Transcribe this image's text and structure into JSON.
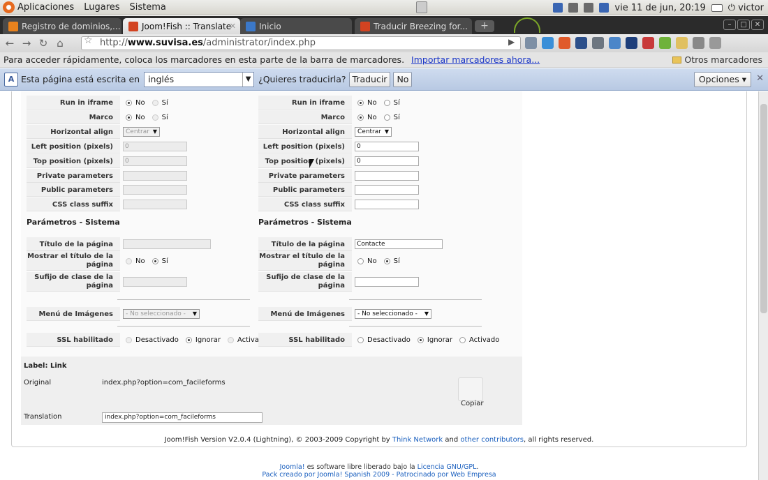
{
  "panel": {
    "menus": [
      "Aplicaciones",
      "Lugares",
      "Sistema"
    ],
    "clock": "vie 11 de jun, 20:19",
    "user": "victor"
  },
  "tabs": [
    {
      "label": "Registro de dominios,...",
      "active": false
    },
    {
      "label": "Joom!Fish :: Translate",
      "active": true
    },
    {
      "label": "Inicio",
      "active": false
    },
    {
      "label": "Traducir Breezing for...",
      "active": false
    }
  ],
  "toolbar": {
    "url_prefix": "http://",
    "url_domain": "www.suvisa.es",
    "url_path": "/administrator/index.php"
  },
  "bookmarks_bar": {
    "message": "Para acceder rápidamente, coloca los marcadores en esta parte de la barra de marcadores.",
    "import_link": "Importar marcadores ahora...",
    "other": "Otros marcadores"
  },
  "translate_bar": {
    "prefix": "Esta página está escrita en",
    "language": "inglés",
    "question": "¿Quieres traducirla?",
    "translate_btn": "Traducir",
    "no_btn": "No",
    "options_btn": "Opciones"
  },
  "columns": [
    {
      "rows": {
        "run_iframe": {
          "key": "Run in iframe",
          "no": "No",
          "si": "Sí",
          "selected": "no"
        },
        "marco": {
          "key": "Marco",
          "no": "No",
          "si": "Sí",
          "selected": "no"
        },
        "halign": {
          "key": "Horizontal align",
          "value": "Centrar"
        },
        "left_pos": {
          "key": "Left position (pixels)",
          "value": "0"
        },
        "top_pos": {
          "key": "Top position (pixels)",
          "value": "0"
        },
        "private_params": {
          "key": "Private parameters",
          "value": ""
        },
        "public_params": {
          "key": "Public parameters",
          "value": ""
        },
        "css_suffix": {
          "key": "CSS class suffix",
          "value": ""
        }
      },
      "system_title": "Parámetros - Sistema",
      "system": {
        "page_title": {
          "key": "Título de la página",
          "value": ""
        },
        "show_title": {
          "key": "Mostrar el título de la página",
          "no": "No",
          "si": "Sí",
          "selected": "si"
        },
        "class_suffix": {
          "key": "Sufijo de clase de la página",
          "value": ""
        },
        "image_menu": {
          "key": "Menú de Imágenes",
          "value": "- No seleccionado -"
        },
        "ssl": {
          "key": "SSL habilitado",
          "off": "Desactivado",
          "ignore": "Ignorar",
          "on": "Activado",
          "selected": "ignore"
        }
      }
    },
    {
      "rows": {
        "run_iframe": {
          "key": "Run in iframe",
          "no": "No",
          "si": "Sí",
          "selected": "no"
        },
        "marco": {
          "key": "Marco",
          "no": "No",
          "si": "Sí",
          "selected": "no"
        },
        "halign": {
          "key": "Horizontal align",
          "value": "Centrar"
        },
        "left_pos": {
          "key": "Left position (pixels)",
          "value": "0"
        },
        "top_pos": {
          "key": "Top position (pixels)",
          "value": "0"
        },
        "private_params": {
          "key": "Private parameters",
          "value": ""
        },
        "public_params": {
          "key": "Public parameters",
          "value": ""
        },
        "css_suffix": {
          "key": "CSS class suffix",
          "value": ""
        }
      },
      "system_title": "Parámetros - Sistema",
      "system": {
        "page_title": {
          "key": "Título de la página",
          "value": "Contacte"
        },
        "show_title": {
          "key": "Mostrar el título de la página",
          "no": "No",
          "si": "Sí",
          "selected": "si"
        },
        "class_suffix": {
          "key": "Sufijo de clase de la página",
          "value": ""
        },
        "image_menu": {
          "key": "Menú de Imágenes",
          "value": "- No seleccionado -"
        },
        "ssl": {
          "key": "SSL habilitado",
          "off": "Desactivado",
          "ignore": "Ignorar",
          "on": "Activado",
          "selected": "ignore"
        }
      }
    }
  ],
  "label_section": {
    "title": "Label: Link",
    "original_key": "Original",
    "original_value": "index.php?option=com_facileforms",
    "copy": "Copiar",
    "translation_key": "Translation",
    "translation_value": "index.php?option=com_facileforms"
  },
  "credit": {
    "text_before": "Joom!Fish Version V2.0.4 (Lightning), © 2003-2009 Copyright by",
    "think_network": "Think Network",
    "and": "and",
    "other_contributors": "other contributors",
    "text_after": ", all rights reserved."
  },
  "footer": {
    "joomla": "Joomla!",
    "line1_mid": "es software libre liberado bajo la",
    "license": "Licencia GNU/GPL",
    "line1_end": ".",
    "line2": "Pack creado por Joomla! Spanish 2009 - Patrocinado por Web Empresa"
  }
}
